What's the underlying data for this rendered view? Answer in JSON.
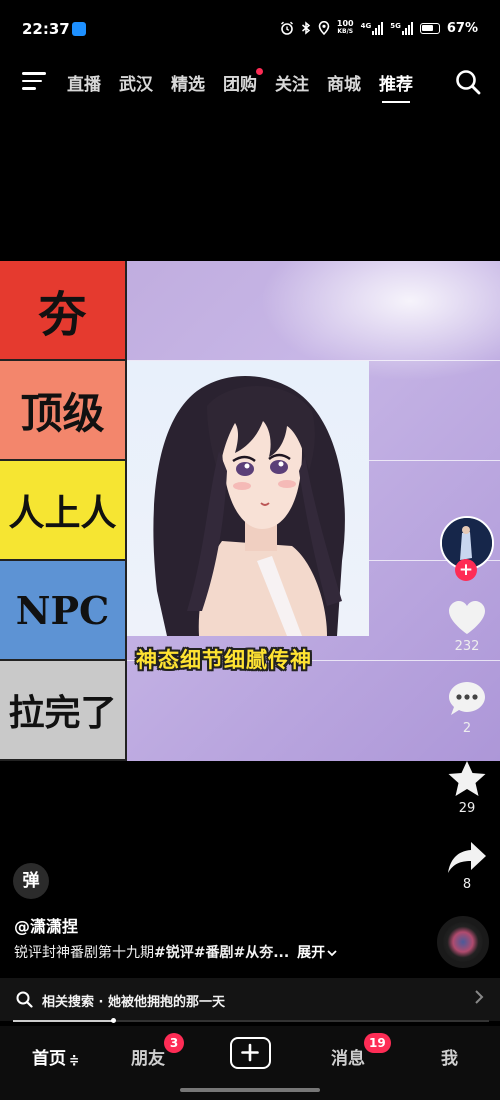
{
  "status_bar": {
    "time": "22:37",
    "net_speed_value": "100",
    "net_speed_unit": "KB/S",
    "signal_1_tag": "4G",
    "signal_2_tag": "5G",
    "battery": "67%",
    "icons": [
      "app-notification-icon",
      "alarm-icon",
      "bluetooth-icon",
      "location-icon",
      "signal-icon",
      "battery-icon"
    ]
  },
  "top_nav": {
    "tabs": [
      {
        "label": "直播",
        "active": false
      },
      {
        "label": "武汉",
        "active": false
      },
      {
        "label": "精选",
        "active": false
      },
      {
        "label": "团购",
        "active": false,
        "dot": true
      },
      {
        "label": "关注",
        "active": false
      },
      {
        "label": "商城",
        "active": false
      },
      {
        "label": "推荐",
        "active": true
      }
    ]
  },
  "video": {
    "tiers": [
      {
        "label": "夯",
        "color": "#e53a2f"
      },
      {
        "label": "顶级",
        "color": "#f3866c"
      },
      {
        "label": "人上人",
        "color": "#f6e532"
      },
      {
        "label": "NPC",
        "color": "#5d93d4"
      },
      {
        "label": "拉完了",
        "color": "#c9c9c9"
      }
    ],
    "caption": "神态细节细腻传神"
  },
  "actions": {
    "likes": "232",
    "comments": "2",
    "favorites": "29",
    "shares": "8",
    "follow_plus": "+"
  },
  "danmu_button": "弹",
  "post": {
    "author": "@潇潇捏",
    "desc_plain": "锐评封神番剧第十九期",
    "desc_tags": "#锐评#番剧#从夯...",
    "expand_label": "展开"
  },
  "related_search": {
    "prefix": "相关搜索",
    "separator": "·",
    "query": "她被他拥抱的那一天"
  },
  "playback": {
    "progress": 0.21
  },
  "bottom_nav": {
    "home": "首页",
    "home_suffix": "≑",
    "friends": "朋友",
    "friends_badge": "3",
    "messages": "消息",
    "messages_badge": "19",
    "me": "我"
  },
  "colors": {
    "accent": "#fe2c55",
    "caption": "#ffe332",
    "video_bg": "#c0acdf"
  }
}
